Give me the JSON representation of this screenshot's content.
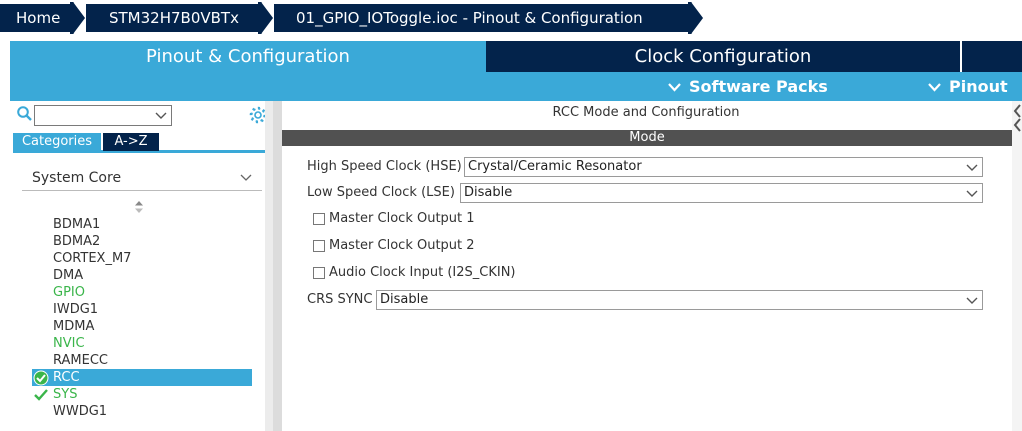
{
  "breadcrumb": {
    "items": [
      "Home",
      "STM32H7B0VBTx",
      "01_GPIO_IOToggle.ioc - Pinout & Configuration"
    ]
  },
  "tabs": {
    "pinout": "Pinout & Configuration",
    "clock": "Clock Configuration"
  },
  "subbar": {
    "software_packs": "Software Packs",
    "pinout": "Pinout"
  },
  "left": {
    "search_value": "",
    "category_tabs": [
      "Categories",
      "A->Z"
    ],
    "group_label": "System Core",
    "items": [
      {
        "label": "BDMA1",
        "state": "normal"
      },
      {
        "label": "BDMA2",
        "state": "normal"
      },
      {
        "label": "CORTEX_M7",
        "state": "normal"
      },
      {
        "label": "DMA",
        "state": "normal"
      },
      {
        "label": "GPIO",
        "state": "green"
      },
      {
        "label": "IWDG1",
        "state": "normal"
      },
      {
        "label": "MDMA",
        "state": "normal"
      },
      {
        "label": "NVIC",
        "state": "green"
      },
      {
        "label": "RAMECC",
        "state": "normal"
      },
      {
        "label": "RCC",
        "state": "selected-check"
      },
      {
        "label": "SYS",
        "state": "green-check"
      },
      {
        "label": "WWDG1",
        "state": "normal"
      }
    ]
  },
  "right": {
    "title": "RCC Mode and Configuration",
    "mode_header": "Mode",
    "hse_label": "High Speed Clock (HSE)",
    "hse_value": "Crystal/Ceramic Resonator",
    "lse_label": "Low Speed Clock (LSE)",
    "lse_value": "Disable",
    "mco1_label": "Master Clock Output 1",
    "mco2_label": "Master Clock Output 2",
    "i2s_label": "Audio Clock Input (I2S_CKIN)",
    "crs_label": "CRS SYNC",
    "crs_value": "Disable"
  },
  "colors": {
    "navy": "#03234b",
    "accent": "#3aa9d8",
    "green": "#3ab54a"
  }
}
